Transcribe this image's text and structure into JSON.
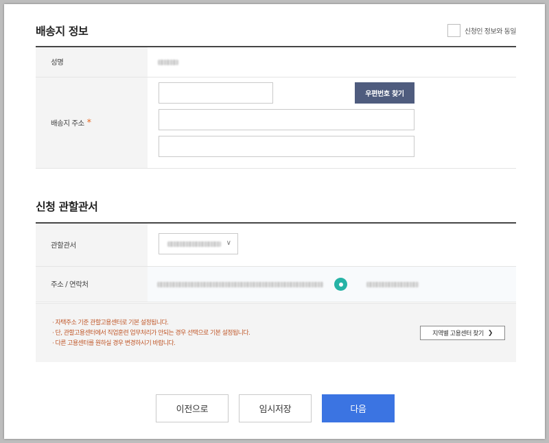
{
  "shipping": {
    "title": "배송지 정보",
    "same_as_applicant_label": "신청인 정보와 동일",
    "name_label": "성명",
    "address_label": "배송지 주소",
    "required_mark": "*",
    "zip_button_label": "우편번호 찾기",
    "zip_value": "",
    "address1_value": "",
    "address2_value": ""
  },
  "jurisdiction": {
    "title": "신청 관할관서",
    "office_label": "관할관서",
    "contact_label": "주소 / 연락처",
    "notices": [
      "자택주소 기준 관할고용센터로 기본 설정됩니다.",
      "단, 관할고용센터에서 직업훈련 업무처리가 안되는 경우 선택으로 기본 설정됩니다.",
      "다른 고용센터를 원하실 경우 변경하시기 바랍니다."
    ],
    "region_button_label": "지역별 고용센터 찾기",
    "region_button_arrow": "❯"
  },
  "footer": {
    "prev_label": "이전으로",
    "save_label": "임시저장",
    "next_label": "다음"
  },
  "colors": {
    "primary": "#3b74e2",
    "zip_button": "#4f5c7e",
    "required": "#e8661c",
    "notice_text": "#c0582a",
    "pin": "#26b3a6"
  },
  "icons": {
    "location": "map-pin-icon",
    "dropdown": "chevron-down-icon",
    "region_arrow": "chevron-right-icon"
  }
}
